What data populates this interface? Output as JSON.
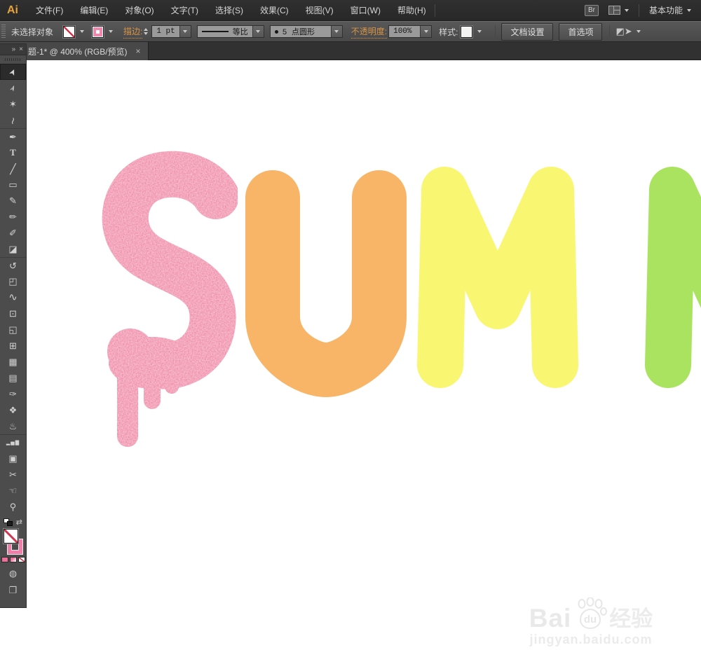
{
  "menu_bar": {
    "logo": "Ai",
    "items": [
      "文件(F)",
      "编辑(E)",
      "对象(O)",
      "文字(T)",
      "选择(S)",
      "效果(C)",
      "视图(V)",
      "窗口(W)",
      "帮助(H)"
    ],
    "bridge_button": "Br",
    "workspace_switcher": "基本功能"
  },
  "control_bar": {
    "status": "未选择对象",
    "stroke_label": "描边:",
    "stroke_width_value": "1 pt",
    "stroke_profile": "等比",
    "brush_definition": "5 点圆形",
    "opacity_label": "不透明度:",
    "opacity_value": "100%",
    "style_label": "样式:",
    "document_setup_button": "文档设置",
    "preferences_button": "首选项"
  },
  "document_tab": {
    "title": "题-1* @ 400% (RGB/预览)",
    "close_glyph": "×"
  },
  "tools_panel": {
    "collapse_glyph": "»",
    "close_glyph": "×",
    "stroke_swatch_color": "#ef7fa9",
    "tools": [
      {
        "name": "selection-tool",
        "glyph": "➤",
        "active": true
      },
      {
        "name": "direct-selection-tool",
        "glyph": "➢"
      },
      {
        "name": "magic-wand-tool",
        "glyph": "✶"
      },
      {
        "name": "lasso-tool",
        "glyph": "≀"
      },
      {
        "name": "pen-tool",
        "glyph": "✒"
      },
      {
        "name": "type-tool",
        "glyph": "T"
      },
      {
        "name": "line-segment-tool",
        "glyph": "╱"
      },
      {
        "name": "rectangle-tool",
        "glyph": "▭"
      },
      {
        "name": "paintbrush-tool",
        "glyph": "✎"
      },
      {
        "name": "pencil-tool",
        "glyph": "✏"
      },
      {
        "name": "blob-brush-tool",
        "glyph": "✐"
      },
      {
        "name": "eraser-tool",
        "glyph": "◪"
      },
      {
        "name": "rotate-tool",
        "glyph": "↺"
      },
      {
        "name": "scale-tool",
        "glyph": "◰"
      },
      {
        "name": "width-tool",
        "glyph": "∿"
      },
      {
        "name": "free-transform-tool",
        "glyph": "⊡"
      },
      {
        "name": "shape-builder-tool",
        "glyph": "◱"
      },
      {
        "name": "perspective-grid-tool",
        "glyph": "⊞"
      },
      {
        "name": "mesh-tool",
        "glyph": "▦"
      },
      {
        "name": "gradient-tool",
        "glyph": "▤"
      },
      {
        "name": "eyedropper-tool",
        "glyph": "✑"
      },
      {
        "name": "blend-tool",
        "glyph": "❖"
      },
      {
        "name": "symbol-sprayer-tool",
        "glyph": "♨"
      },
      {
        "name": "column-graph-tool",
        "glyph": "▂▅▇"
      },
      {
        "name": "artboard-tool",
        "glyph": "▣"
      },
      {
        "name": "slice-tool",
        "glyph": "✂"
      },
      {
        "name": "hand-tool",
        "glyph": "☜"
      },
      {
        "name": "zoom-tool",
        "glyph": "⚲"
      }
    ]
  },
  "artwork": {
    "visible_text": "SUMM",
    "letters": [
      {
        "char": "S",
        "color": "#ef709b",
        "texture": "grain",
        "style": "melting drips"
      },
      {
        "char": "U",
        "color": "#f8b568"
      },
      {
        "char": "M",
        "color": "#f9f772"
      },
      {
        "char": "M",
        "color": "#a9e35f",
        "note": "clipped at right edge"
      }
    ]
  },
  "watermark": {
    "brand_latin": "Bai",
    "brand_paw": "du",
    "brand_cn": "经验",
    "url": "jingyan.baidu.com"
  }
}
